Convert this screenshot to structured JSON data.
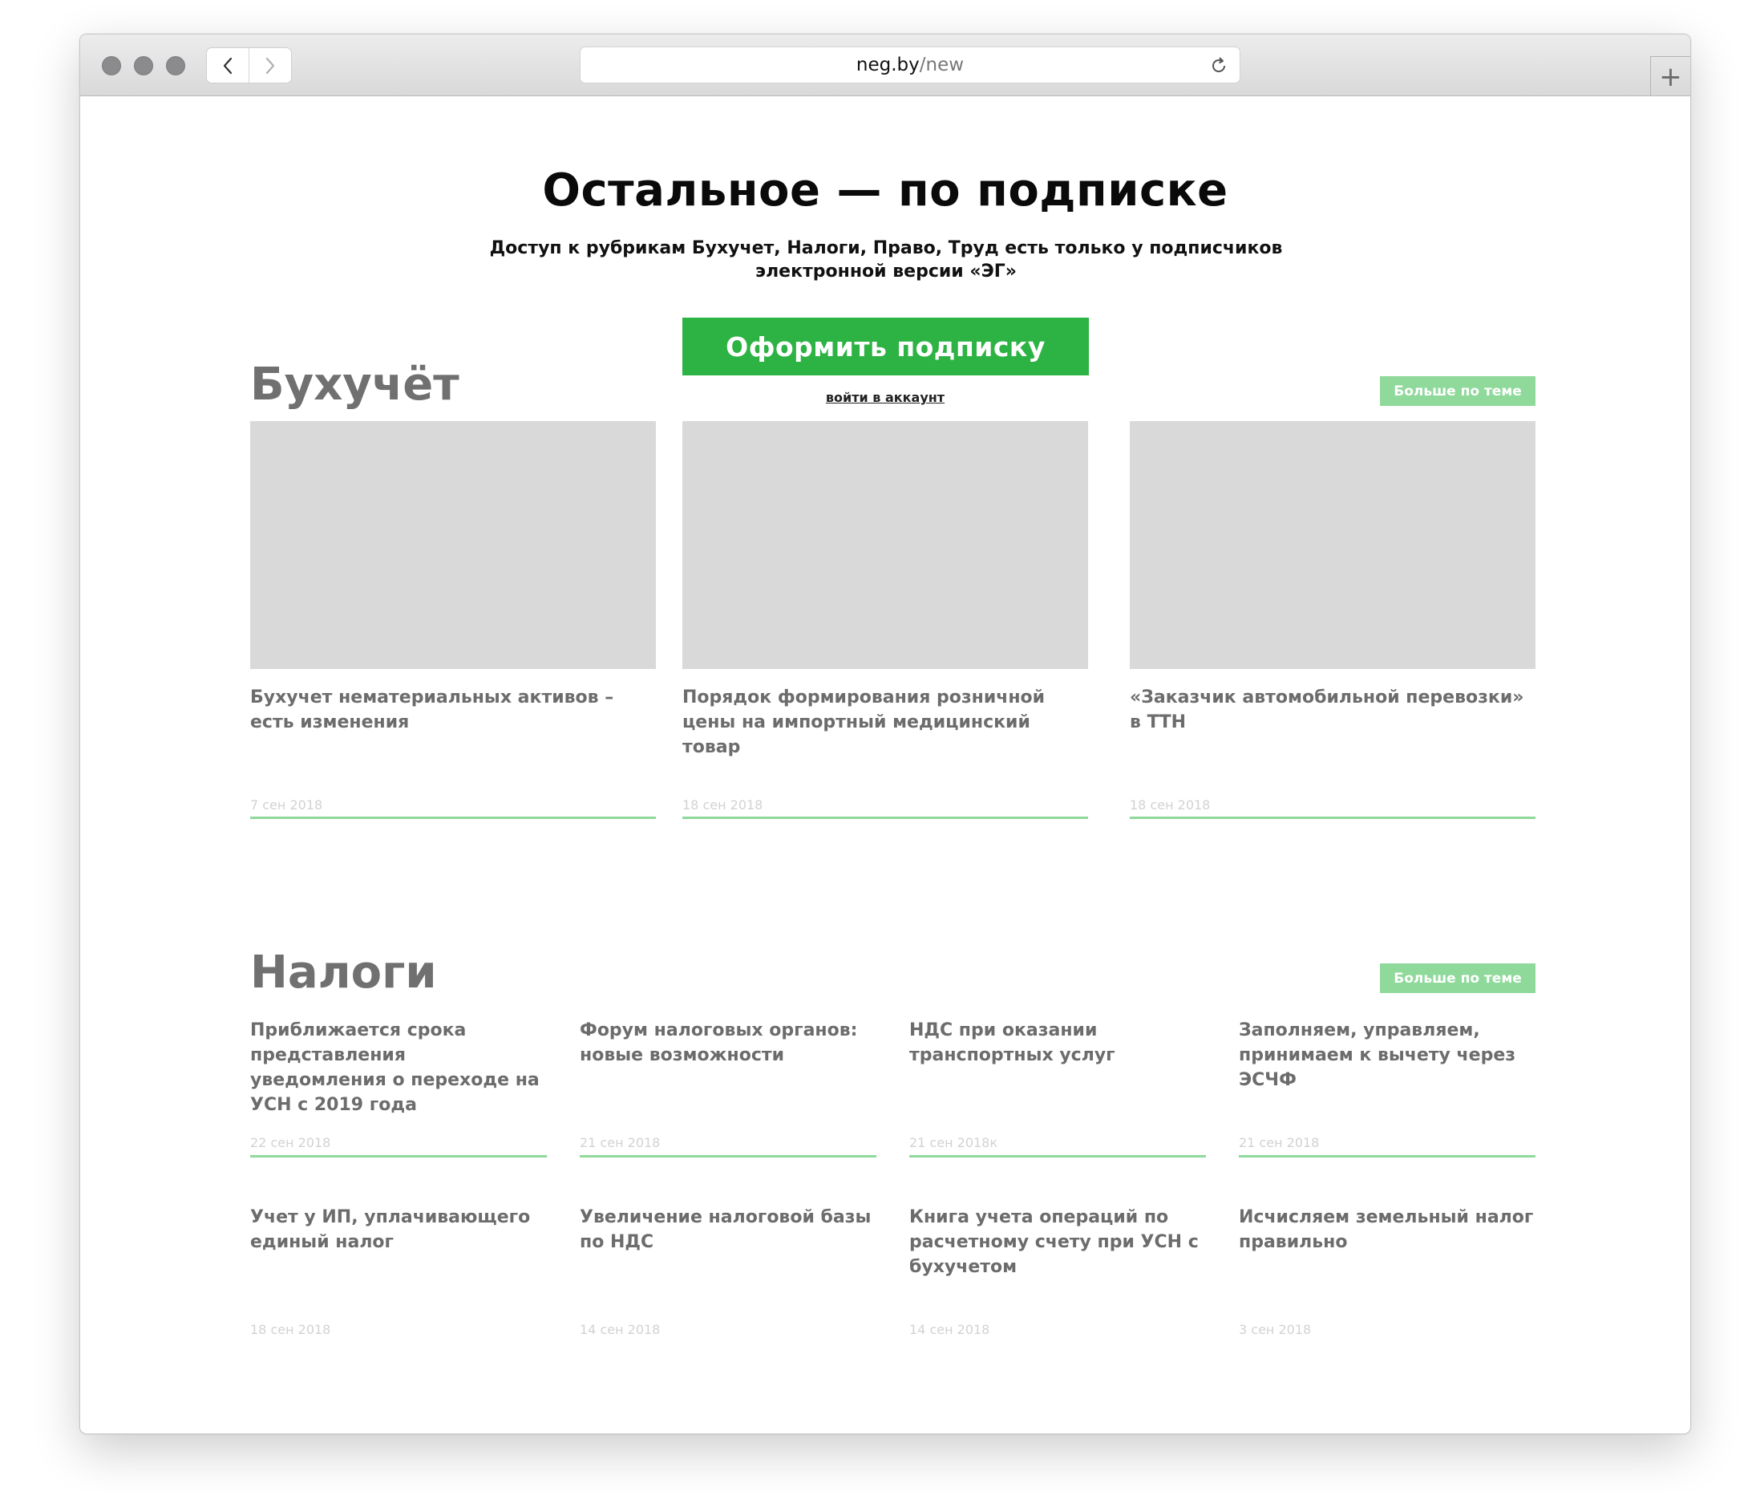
{
  "browser": {
    "url_host": "neg.by",
    "url_path": "/new"
  },
  "hero": {
    "title": "Остальное — по подписке",
    "subtitle_line1": "Доступ к рубрикам Бухучет, Налоги, Право, Труд есть только у подписчиков",
    "subtitle_line2": "электронной версии «ЭГ»",
    "subscribe_label": "Оформить подписку",
    "login_label": "войти в аккаунт"
  },
  "sections": {
    "buhuchet": {
      "title": "Бухучёт",
      "more_label": "Больше по теме",
      "cards": [
        {
          "title": "Бухучет нематериальных активов – есть изменения",
          "date": "7 сен 2018"
        },
        {
          "title": "Порядок формирования розничной цены на импортный медицинский товар",
          "date": "18 сен 2018"
        },
        {
          "title": "«Заказчик автомобильной перевозки» в ТТН",
          "date": "18 сен 2018"
        }
      ]
    },
    "nalogi": {
      "title": "Налоги",
      "more_label": "Больше по теме",
      "cards": [
        {
          "title": "Приближается срока представления уведомления о переходе на УСН с 2019 года",
          "date": "22 сен 2018"
        },
        {
          "title": "Форум налоговых органов: новые возможности",
          "date": "21 сен 2018"
        },
        {
          "title": "НДС при оказании транспортных услуг",
          "date": "21 сен 2018к"
        },
        {
          "title": "Заполняем, управляем, принимаем к вычету через ЭСЧФ",
          "date": "21 сен 2018"
        },
        {
          "title": "Учет у ИП, уплачивающего единый налог",
          "date": "18 сен 2018"
        },
        {
          "title": "Увеличение налоговой базы по НДС",
          "date": "14 сен 2018"
        },
        {
          "title": "Книга учета операций по расчетному счету при УСН с бухучетом",
          "date": "14 сен 2018"
        },
        {
          "title": "Исчисляем земельный налог правильно",
          "date": "3 сен 2018"
        }
      ]
    }
  }
}
